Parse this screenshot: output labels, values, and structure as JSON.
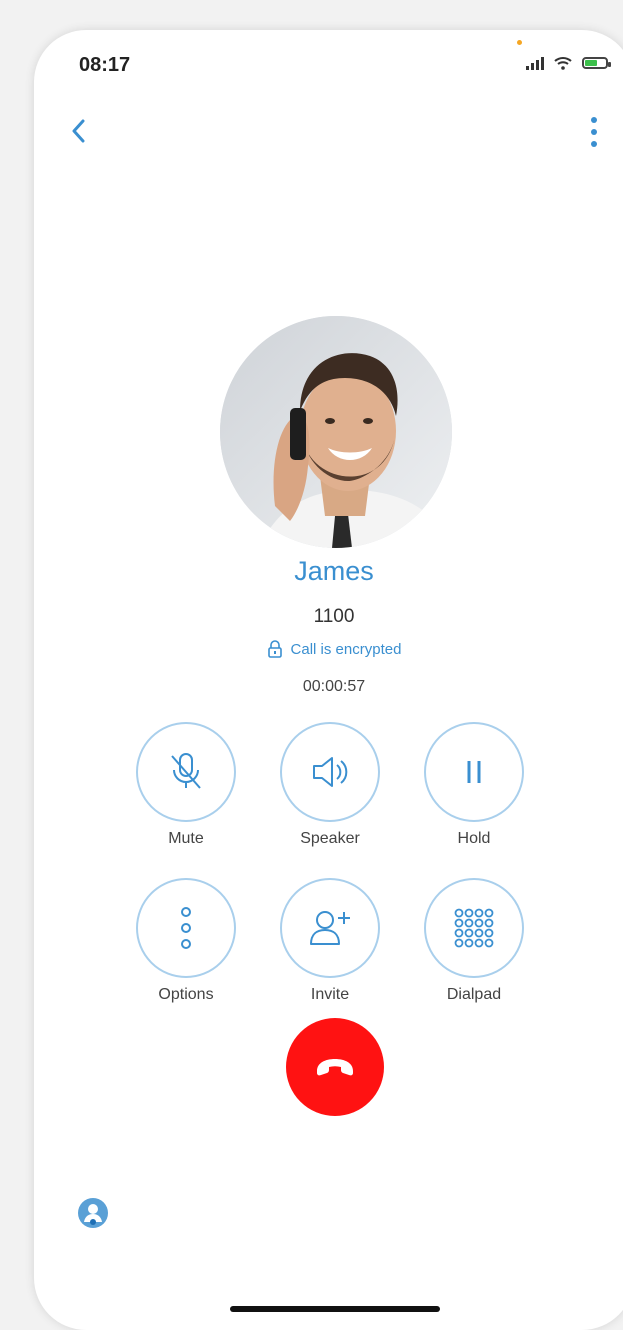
{
  "status_bar": {
    "time": "08:17"
  },
  "caller": {
    "name": "James",
    "number": "1100",
    "encryption_status": "Call is encrypted",
    "duration": "00:00:57"
  },
  "controls": [
    {
      "label": "Mute",
      "icon": "mic-off-icon"
    },
    {
      "label": "Speaker",
      "icon": "speaker-icon"
    },
    {
      "label": "Hold",
      "icon": "pause-icon"
    },
    {
      "label": "Options",
      "icon": "dots-vertical-icon"
    },
    {
      "label": "Invite",
      "icon": "add-person-icon"
    },
    {
      "label": "Dialpad",
      "icon": "dialpad-icon"
    }
  ],
  "colors": {
    "accent": "#3a8fd0",
    "control_border": "#a9cfec",
    "hangup": "#ff1212"
  }
}
